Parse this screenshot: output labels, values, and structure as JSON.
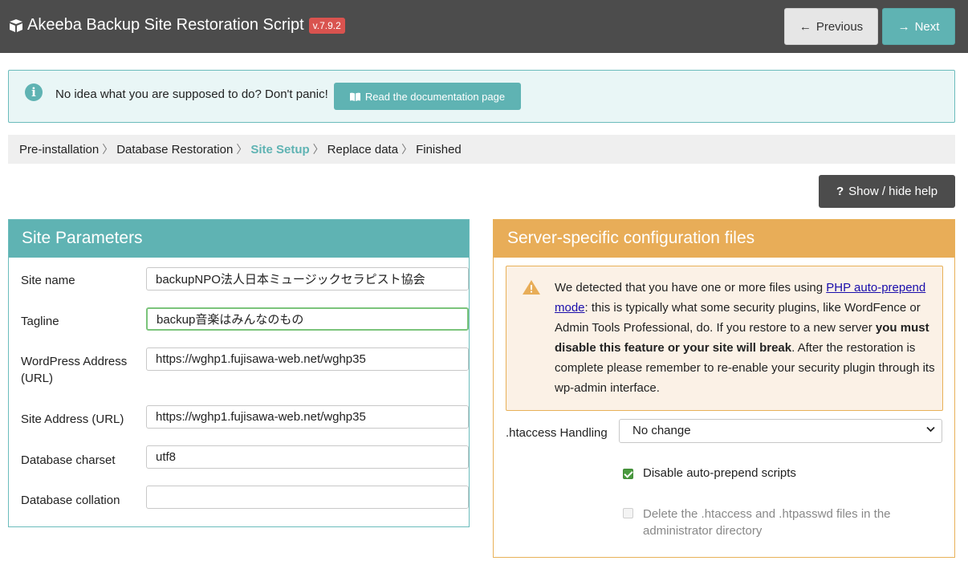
{
  "header": {
    "title": "Akeeba Backup Site Restoration Script",
    "version": "v.7.9.2",
    "prev_label": "Previous",
    "next_label": "Next"
  },
  "info_alert": {
    "text": "No idea what you are supposed to do? Don't panic!",
    "doc_button": "Read the documentation page"
  },
  "breadcrumb": {
    "items": [
      "Pre-installation",
      "Database Restoration",
      "Site Setup",
      "Replace data",
      "Finished"
    ],
    "active": "Site Setup"
  },
  "help_button": "Show / hide help",
  "site_params": {
    "title": "Site Parameters",
    "fields": [
      {
        "label": "Site name",
        "value": "backupNPO法人日本ミュージックセラピスト協会"
      },
      {
        "label": "Tagline",
        "value": "backup音楽はみんなのもの"
      },
      {
        "label": "WordPress Address (URL)",
        "value": "https://wghp1.fujisawa-web.net/wghp35"
      },
      {
        "label": "Site Address (URL)",
        "value": "https://wghp1.fujisawa-web.net/wghp35"
      },
      {
        "label": "Database charset",
        "value": "utf8"
      },
      {
        "label": "Database collation",
        "value": ""
      }
    ]
  },
  "server_config": {
    "title": "Server-specific configuration files",
    "warning": {
      "t1": "We detected that you have one or more files using ",
      "link": "PHP auto-prepend mode",
      "t2": ": this is typically what some security plugins, like WordFence or Admin Tools Professional, do. If you restore to a new server ",
      "bold": "you must disable this feature or your site will break",
      "t3": ". After the restoration is complete please remember to re-enable your security plugin through its wp-admin interface."
    },
    "htaccess_label": ".htaccess Handling",
    "htaccess_value": "No change",
    "check_prepend": "Disable auto-prepend scripts",
    "check_prepend_checked": true,
    "check_delete": "Delete the .htaccess and .htpasswd files in the administrator directory",
    "check_delete_checked": false
  },
  "colors": {
    "accent": "#5fb3b3",
    "warning": "#e8ad58",
    "header_bg": "#4c4c4c",
    "version_badge": "#d9534f"
  }
}
